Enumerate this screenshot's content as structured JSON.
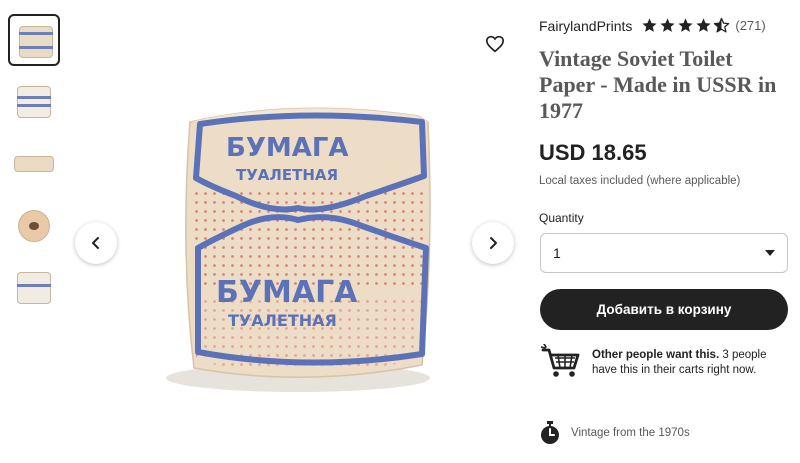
{
  "shop": {
    "name": "FairylandPrints",
    "rating": 4.5,
    "review_count": "(271)"
  },
  "listing": {
    "title": "Vintage Soviet Toilet Paper - Made in USSR in 1977",
    "price": "USD 18.65",
    "tax_note": "Local taxes included (where applicable)"
  },
  "quantity": {
    "label": "Quantity",
    "selected": "1"
  },
  "cart": {
    "add_button": "Добавить в корзину",
    "note_bold": "Other people want this.",
    "note_rest": " 3 people have this in their carts right now."
  },
  "vintage": {
    "text": "Vintage from the 1970s"
  },
  "image_text": {
    "brand_top": "БУМАГА",
    "sub_top": "ТУАЛЕТНАЯ",
    "brand_bottom": "БУМАГА",
    "sub_bottom": "ТУАЛЕТНАЯ"
  },
  "icons": {
    "favorite": "heart-icon",
    "prev": "chevron-left-icon",
    "next": "chevron-right-icon",
    "dropdown": "caret-down-icon",
    "cart": "shopping-cart-icon",
    "vintage": "stopwatch-icon"
  },
  "colors": {
    "button_bg": "#222222",
    "paper": "#eddcc6",
    "print_blue": "#5b72b8",
    "dots_red": "#d97a6c",
    "star": "#222222"
  },
  "thumbnails": [
    {
      "label": "thumbnail-1",
      "selected": true
    },
    {
      "label": "thumbnail-2",
      "selected": false
    },
    {
      "label": "thumbnail-3",
      "selected": false
    },
    {
      "label": "thumbnail-4",
      "selected": false
    },
    {
      "label": "thumbnail-5",
      "selected": false
    }
  ]
}
